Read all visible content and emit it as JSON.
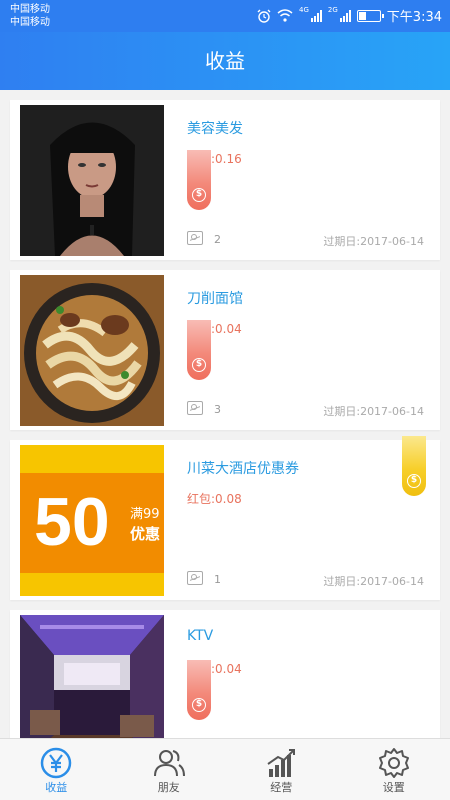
{
  "status_bar": {
    "carrier1": "中国移动",
    "carrier2": "中国移动",
    "net1": "4G",
    "net2": "2G",
    "time": "下午3:34"
  },
  "header": {
    "title": "收益"
  },
  "items": [
    {
      "name": "美容美发",
      "red_packet": "红包:0.16",
      "image_count": "2",
      "expiry": "过期日:2017-06-14",
      "tag_color": "red",
      "thumb_icon": "woman-portrait-photo"
    },
    {
      "name": "刀削面馆",
      "red_packet": "红包:0.04",
      "image_count": "3",
      "expiry": "过期日:2017-06-14",
      "tag_color": "red",
      "thumb_icon": "noodle-bowl-photo"
    },
    {
      "name": "川菜大酒店优惠券",
      "red_packet": "红包:0.08",
      "image_count": "1",
      "expiry": "过期日:2017-06-14",
      "tag_color": "yellow",
      "thumb_icon": "coupon-50-photo",
      "thumb_text": {
        "big": "50",
        "small1": "满99",
        "small2": "优惠"
      }
    },
    {
      "name": "KTV",
      "red_packet": "红包:0.04",
      "tag_color": "red",
      "thumb_icon": "ktv-room-photo"
    }
  ],
  "tag_coin_symbol": "$",
  "tabs": [
    {
      "label": "收益",
      "icon": "yen-circle-icon",
      "active": true
    },
    {
      "label": "朋友",
      "icon": "friends-icon",
      "active": false
    },
    {
      "label": "经营",
      "icon": "bar-chart-icon",
      "active": false
    },
    {
      "label": "设置",
      "icon": "gear-icon",
      "active": false
    }
  ],
  "colors": {
    "accent": "#2b8ee8",
    "header": "#2f7ff1",
    "red_text": "#e8735e",
    "name_text": "#2b9be0"
  }
}
